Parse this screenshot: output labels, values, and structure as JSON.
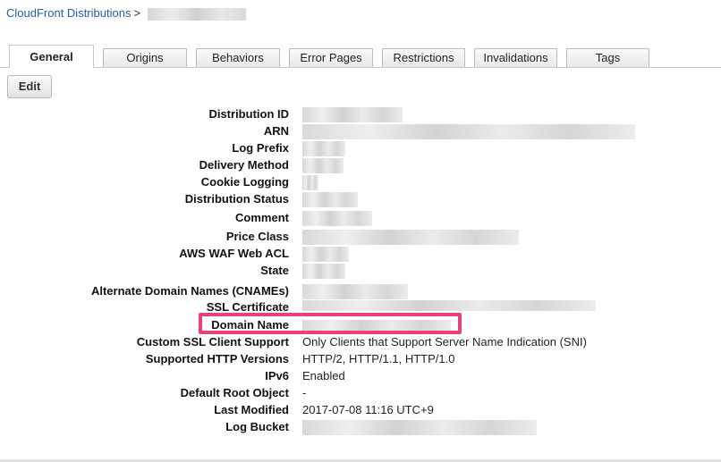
{
  "breadcrumb": {
    "root": "CloudFront Distributions",
    "separator": ">"
  },
  "tabs": [
    {
      "label": "General",
      "active": true
    },
    {
      "label": "Origins"
    },
    {
      "label": "Behaviors"
    },
    {
      "label": "Error Pages"
    },
    {
      "label": "Restrictions"
    },
    {
      "label": "Invalidations"
    },
    {
      "label": "Tags"
    }
  ],
  "edit_label": "Edit",
  "details": [
    {
      "label": "Distribution ID",
      "value": ""
    },
    {
      "label": "ARN",
      "value": ""
    },
    {
      "label": "Log Prefix",
      "value": ""
    },
    {
      "label": "Delivery Method",
      "value": ""
    },
    {
      "label": "Cookie Logging",
      "value": ""
    },
    {
      "label": "Distribution Status",
      "value": ""
    },
    {
      "label": "Comment",
      "value": ""
    },
    {
      "label": "Price Class",
      "value": ""
    },
    {
      "label": "AWS WAF Web ACL",
      "value": ""
    },
    {
      "label": "State",
      "value": ""
    },
    {
      "label": "Alternate Domain Names (CNAMEs)",
      "value": ""
    },
    {
      "label": "SSL Certificate",
      "value": ""
    },
    {
      "label": "Domain Name",
      "value": ""
    },
    {
      "label": "Custom SSL Client Support",
      "value": "Only Clients that Support Server Name Indication (SNI)"
    },
    {
      "label": "Supported HTTP Versions",
      "value": "HTTP/2, HTTP/1.1, HTTP/1.0"
    },
    {
      "label": "IPv6",
      "value": "Enabled"
    },
    {
      "label": "Default Root Object",
      "value": "-"
    },
    {
      "label": "Last Modified",
      "value": "2017-07-08 11:16 UTC+9"
    },
    {
      "label": "Log Bucket",
      "value": ""
    }
  ],
  "colors": {
    "link": "#1f5fa8",
    "highlight": "#e8417f"
  }
}
